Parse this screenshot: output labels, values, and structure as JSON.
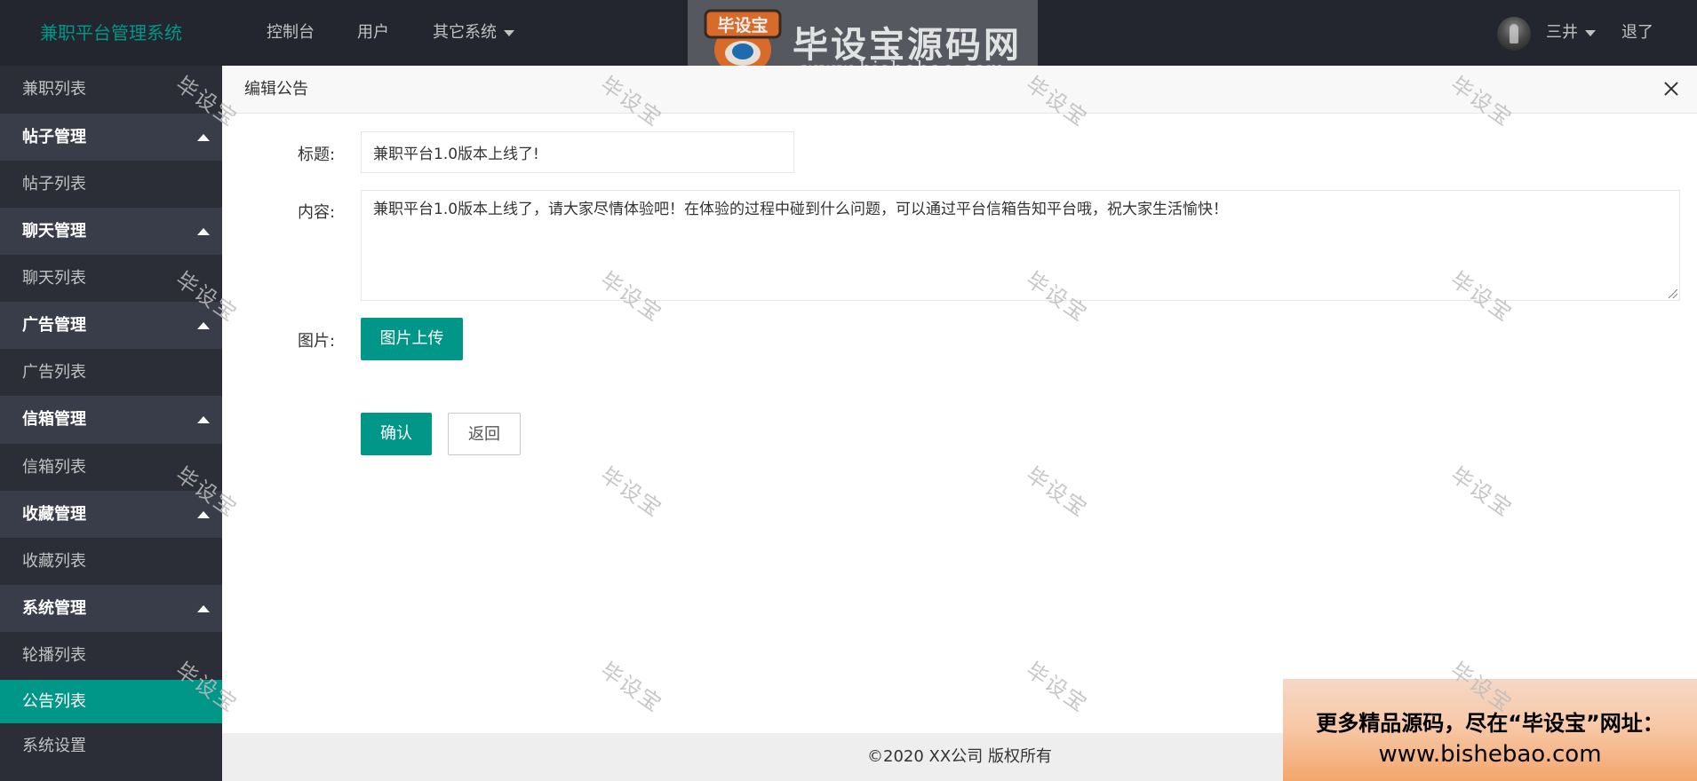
{
  "header": {
    "app_title": "兼职平台管理系统",
    "nav": [
      {
        "label": "控制台"
      },
      {
        "label": "用户"
      },
      {
        "label": "其它系统"
      }
    ],
    "user_name": "三井",
    "logout": "退了"
  },
  "banner": {
    "badge": "毕设宝",
    "title": "毕设宝源码网",
    "url": "www.bishebao.com"
  },
  "sidebar": {
    "items": [
      {
        "label": "兼职列表",
        "kind": "child"
      },
      {
        "label": "帖子管理",
        "kind": "group"
      },
      {
        "label": "帖子列表",
        "kind": "child"
      },
      {
        "label": "聊天管理",
        "kind": "group"
      },
      {
        "label": "聊天列表",
        "kind": "child"
      },
      {
        "label": "广告管理",
        "kind": "group"
      },
      {
        "label": "广告列表",
        "kind": "child"
      },
      {
        "label": "信箱管理",
        "kind": "group"
      },
      {
        "label": "信箱列表",
        "kind": "child"
      },
      {
        "label": "收藏管理",
        "kind": "group"
      },
      {
        "label": "收藏列表",
        "kind": "child"
      },
      {
        "label": "系统管理",
        "kind": "group"
      },
      {
        "label": "轮播列表",
        "kind": "child"
      },
      {
        "label": "公告列表",
        "kind": "active"
      },
      {
        "label": "系统设置",
        "kind": "child"
      }
    ]
  },
  "panel": {
    "title": "编辑公告"
  },
  "form": {
    "title_label": "标题:",
    "title_value": "兼职平台1.0版本上线了!",
    "content_label": "内容:",
    "content_value": "兼职平台1.0版本上线了，请大家尽情体验吧！在体验的过程中碰到什么问题，可以通过平台信箱告知平台哦，祝大家生活愉快！",
    "image_label": "图片:",
    "upload_button": "图片上传",
    "confirm_button": "确认",
    "back_button": "返回"
  },
  "footer": {
    "text": "©2020 XX公司 版权所有"
  },
  "promo": {
    "line1": "更多精品源码，尽在“毕设宝”网址：",
    "line2": "www.bishebao.com"
  },
  "watermark": {
    "text": "毕设宝"
  },
  "colors": {
    "accent": "#009688",
    "header_bg": "#23262e",
    "sidebar_bg": "#393d49",
    "sidebar_child_bg": "#2b2e37"
  }
}
